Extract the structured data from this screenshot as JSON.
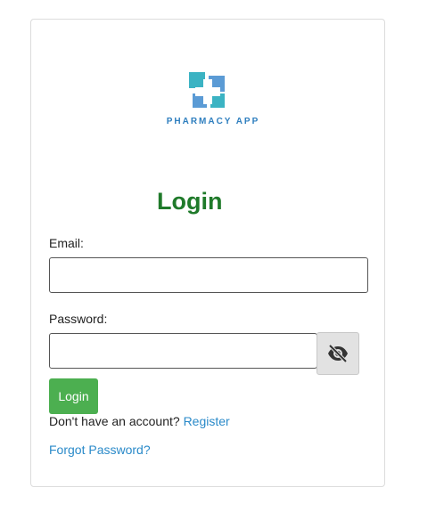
{
  "logo": {
    "icon": "pharmacy-cross-logo",
    "text": "PHARMACY APP"
  },
  "form": {
    "title": "Login",
    "email_label": "Email:",
    "email_value": "",
    "password_label": "Password:",
    "password_value": "",
    "toggle_icon": "eye-off-icon",
    "submit_label": "Login"
  },
  "links": {
    "register_prompt": "Don't have an account?",
    "register_label": "Register",
    "forgot_label": "Forgot Password?"
  },
  "colors": {
    "title": "#1f7a2a",
    "button": "#4caf50",
    "link": "#2a8ac9",
    "logo_text": "#2f7fbf"
  }
}
